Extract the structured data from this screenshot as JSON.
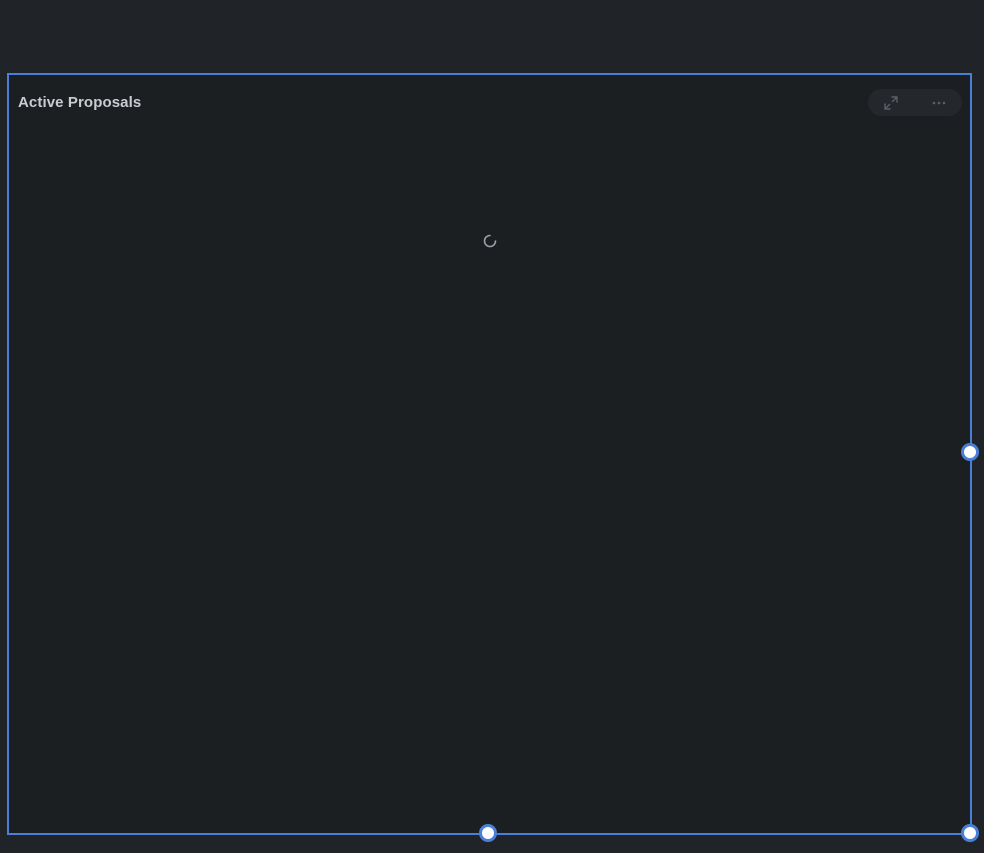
{
  "widget": {
    "title": "Active Proposals",
    "state": "loading",
    "toolbar": {
      "expand_icon": "expand-icon",
      "more_icon": "more-options-icon"
    }
  },
  "colors": {
    "background": "#202327",
    "panel": "#1c1f22",
    "selection_border": "#4a7fd8",
    "title_text": "#c9ccd0"
  }
}
